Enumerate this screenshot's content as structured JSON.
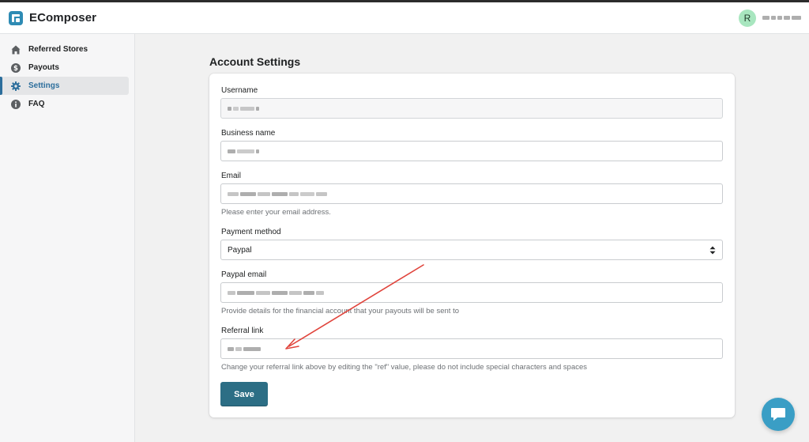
{
  "app": {
    "brand_name": "EComposer"
  },
  "user": {
    "avatar_initial": "R"
  },
  "sidebar": {
    "items": [
      {
        "label": "Referred Stores",
        "icon": "home-icon",
        "active": false
      },
      {
        "label": "Payouts",
        "icon": "dollar-icon",
        "active": false
      },
      {
        "label": "Settings",
        "icon": "gear-icon",
        "active": true
      },
      {
        "label": "FAQ",
        "icon": "info-icon",
        "active": false
      }
    ]
  },
  "page": {
    "title": "Account Settings"
  },
  "form": {
    "username": {
      "label": "Username"
    },
    "business_name": {
      "label": "Business name"
    },
    "email": {
      "label": "Email",
      "help": "Please enter your email address."
    },
    "payment_method": {
      "label": "Payment method",
      "value": "Paypal"
    },
    "paypal_email": {
      "label": "Paypal email",
      "help": "Provide details for the financial account that your payouts will be sent to"
    },
    "referral_link": {
      "label": "Referral link",
      "help": "Change your referral link above by editing the \"ref\" value, please do not include special characters and spaces"
    },
    "save_label": "Save"
  },
  "colors": {
    "accent": "#2c6e85",
    "chat": "#3a9ec5",
    "annotation_arrow": "#e0443c"
  }
}
